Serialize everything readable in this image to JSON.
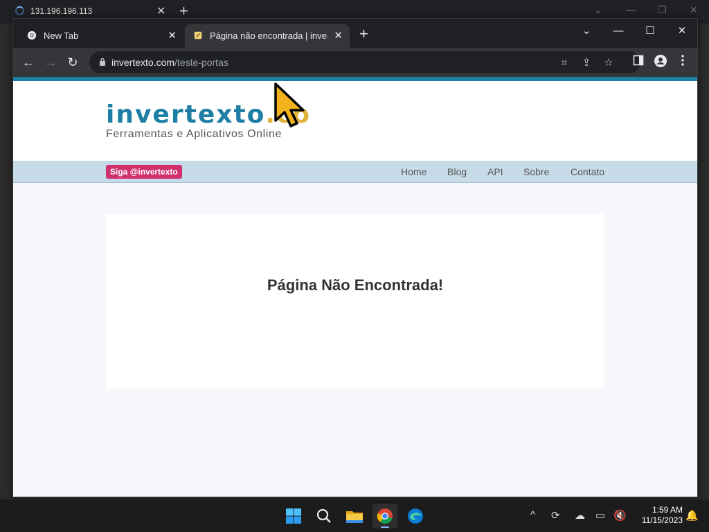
{
  "outer_browser": {
    "tab_title": "131.196.196.113"
  },
  "browser": {
    "tabs": [
      {
        "title": "New Tab"
      },
      {
        "title": "Página não encontrada | invertexto"
      }
    ],
    "address": {
      "domain": "invertexto.com",
      "path": "/teste-portas"
    }
  },
  "site": {
    "logo_main": "invertexto",
    "logo_tld": ".co",
    "logo_tagline": "Ferramentas e Aplicativos Online",
    "follow_badge": "Siga @invertexto",
    "nav": [
      "Home",
      "Blog",
      "API",
      "Sobre",
      "Contato"
    ],
    "message": "Página Não Encontrada!"
  },
  "taskbar": {
    "time": "1:59 AM",
    "date": "11/15/2023"
  },
  "colors": {
    "brand_blue": "#1e7ea3",
    "brand_gold": "#e2b33a",
    "badge_pink": "#d0306b",
    "nav_bg": "#c7dae8"
  }
}
